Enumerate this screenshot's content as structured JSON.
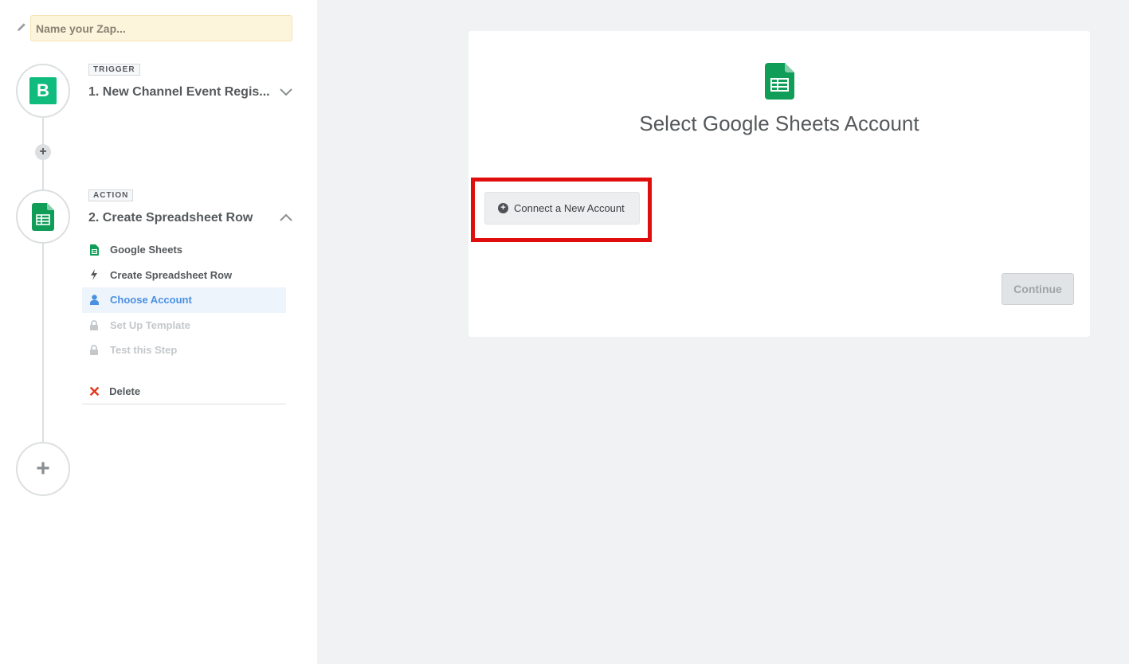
{
  "zap": {
    "name_placeholder": "Name your Zap...",
    "name_value": ""
  },
  "trigger": {
    "tag": "TRIGGER",
    "logo_letter": "B",
    "title": "1. New Channel Event Regis...",
    "logo_color": "#0fbb7d"
  },
  "action": {
    "tag": "ACTION",
    "title": "2. Create Spreadsheet Row",
    "substeps": [
      {
        "label": "Google Sheets",
        "icon": "google-sheets-icon",
        "state": "done"
      },
      {
        "label": "Create Spreadsheet Row",
        "icon": "lightning-bolt-icon",
        "state": "done"
      },
      {
        "label": "Choose Account",
        "icon": "user-icon",
        "state": "active"
      },
      {
        "label": "Set Up Template",
        "icon": "lock-icon",
        "state": "locked"
      },
      {
        "label": "Test this Step",
        "icon": "lock-icon",
        "state": "locked"
      }
    ],
    "delete_label": "Delete"
  },
  "main": {
    "title": "Select Google Sheets Account",
    "connect_label": "Connect a New Account",
    "continue_label": "Continue",
    "highlight_color": "#e00d0d"
  },
  "colors": {
    "active": "#4a90e2",
    "sheets_green": "#0f9d58",
    "delete_red": "#e5361c"
  }
}
